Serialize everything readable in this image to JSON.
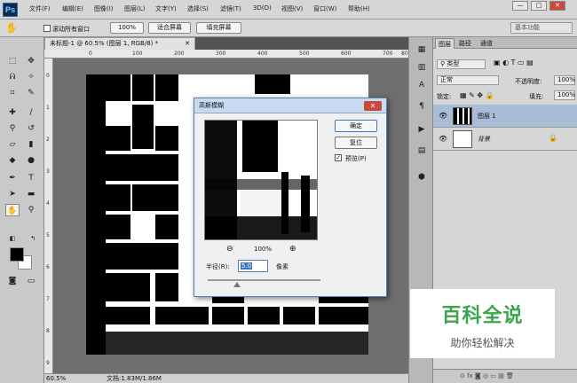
{
  "app": {
    "logo": "Ps"
  },
  "menu": [
    "文件(F)",
    "编辑(E)",
    "图像(I)",
    "图层(L)",
    "文字(Y)",
    "选择(S)",
    "滤镜(T)",
    "3D(D)",
    "视图(V)",
    "窗口(W)",
    "帮助(H)"
  ],
  "window_controls": {
    "minimize": "—",
    "maximize": "□",
    "close": "✕"
  },
  "options_bar": {
    "tool_icon": "hand-icon",
    "scroll_all_windows": "滚动所有窗口",
    "zoom_100": "100%",
    "fit_screen": "适合屏幕",
    "fill_screen": "填充屏幕",
    "workspace": "基本功能"
  },
  "document": {
    "tab_title": "未标题-1 @ 60.5% (图层 1, RGB/8) *",
    "tab_close": "✕",
    "ruler_labels": [
      "0",
      "100",
      "200",
      "300",
      "400",
      "500",
      "600",
      "700",
      "800"
    ],
    "ruler_labels_left": [
      "0",
      "1",
      "2",
      "3",
      "4",
      "5",
      "6",
      "7",
      "8",
      "9"
    ]
  },
  "status": {
    "zoom": "60.5%",
    "doc_info": "文档:1.83M/1.86M"
  },
  "dialog": {
    "title": "高斯模糊",
    "close": "✕",
    "ok": "确定",
    "reset": "复位",
    "preview_label": "预览(P)",
    "preview_checked": true,
    "zoom_out": "⊖",
    "zoom_value": "100%",
    "zoom_in": "⊕",
    "radius_label": "半径(R):",
    "radius_value": "5.0",
    "radius_unit": "像素",
    "radius_slider_fraction": 0.2
  },
  "panels": {
    "tabs": [
      "图层",
      "路径",
      "通道"
    ],
    "filter_kind": "类型",
    "blend_mode": "正常",
    "opacity_label": "不透明度:",
    "opacity_value": "100%",
    "lock_label": "锁定:",
    "fill_label": "填充:",
    "fill_value": "100%",
    "layers": [
      {
        "name": "图层 1",
        "selected": true
      },
      {
        "name": "背景",
        "selected": false,
        "locked": true
      }
    ],
    "bottom_icons": "⊙ fx ◙ ◎ ▭ ▤ 🗑"
  },
  "watermark": {
    "title": "百科全说",
    "subtitle": "助你轻松解决"
  }
}
